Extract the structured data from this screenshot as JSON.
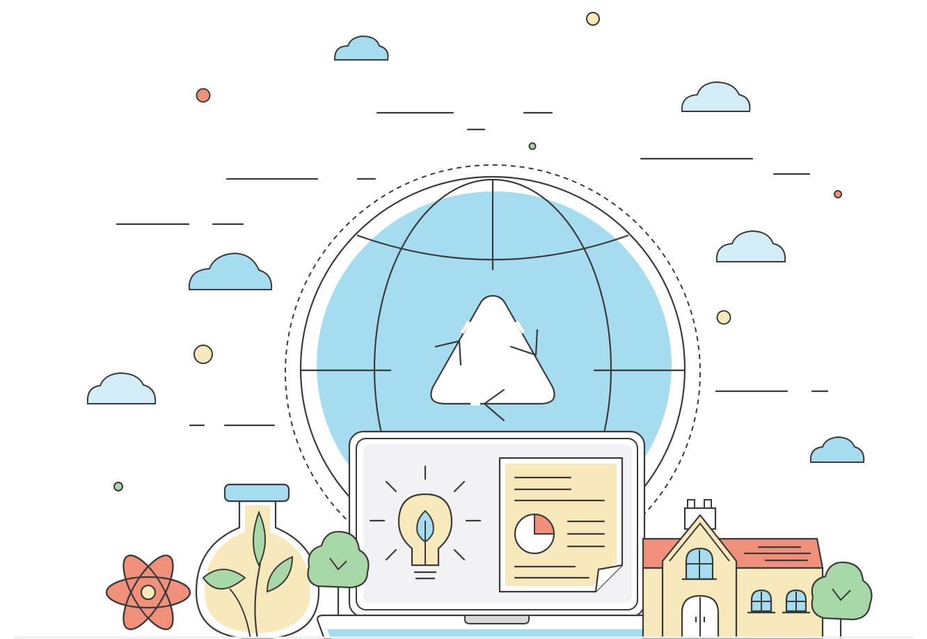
{
  "illustration": {
    "subject": "eco-technology-line-art",
    "colors": {
      "outline": "#3a3a3a",
      "sky_blue": "#a6dcef",
      "light_blue": "#d3edf7",
      "cream": "#f8e9bd",
      "coral": "#f1907a",
      "green": "#a8d8a8",
      "screen_gray": "#f2f2f4",
      "white": "#ffffff"
    },
    "icons": [
      "globe-icon",
      "recycle-icon",
      "laptop-icon",
      "lightbulb-icon",
      "leaf-icon",
      "document-icon",
      "pie-chart-icon",
      "flask-icon",
      "plant-icon",
      "atom-icon",
      "tree-icon",
      "house-icon",
      "cloud-icon"
    ]
  }
}
